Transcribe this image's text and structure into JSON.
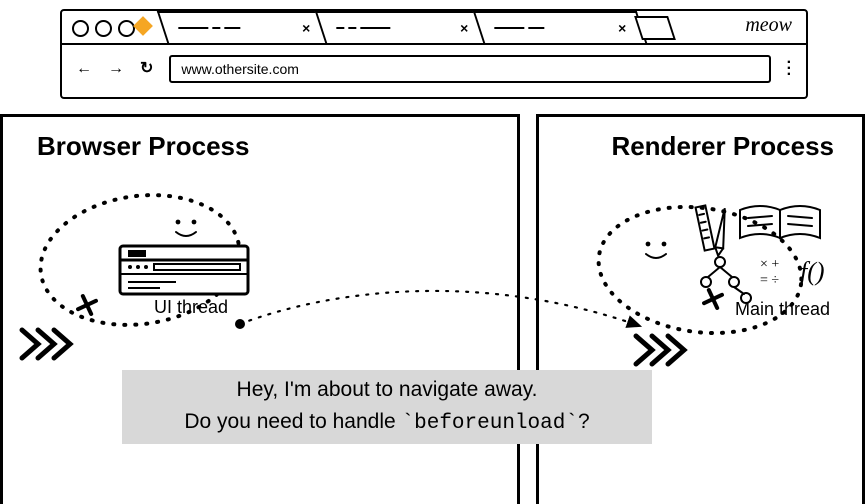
{
  "browser": {
    "brand_text": "meow",
    "url": "www.othersite.com",
    "nav": {
      "back": "←",
      "fwd": "→",
      "reload": "↻"
    },
    "tabs": [
      {
        "close": "×"
      },
      {
        "close": "×"
      },
      {
        "close": "×"
      }
    ]
  },
  "panels": {
    "left_title": "Browser Process",
    "right_title": "Renderer Process",
    "ui_thread_label": "UI thread",
    "main_thread_label": "Main thread"
  },
  "message": {
    "line1": "Hey, I'm about to navigate away.",
    "line2_pre": "Do you need to handle ",
    "line2_code": "`beforeunload`",
    "line2_post": "?"
  }
}
